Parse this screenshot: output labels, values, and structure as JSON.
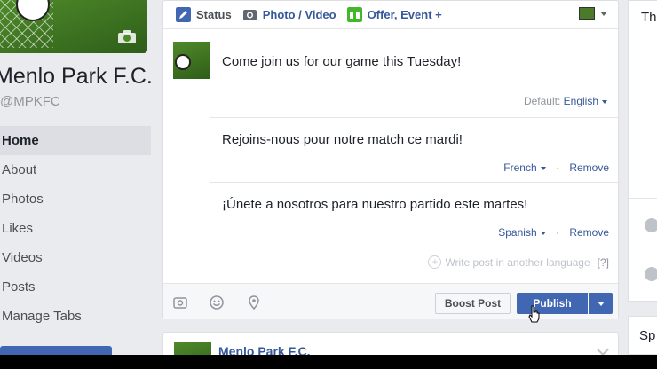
{
  "left": {
    "page_name": "Menlo Park F.C.",
    "page_handle": "@MPKFC",
    "nav": [
      {
        "label": "Home",
        "active": true
      },
      {
        "label": "About"
      },
      {
        "label": "Photos"
      },
      {
        "label": "Likes"
      },
      {
        "label": "Videos"
      },
      {
        "label": "Posts"
      },
      {
        "label": "Manage Tabs"
      }
    ]
  },
  "composer": {
    "tabs": {
      "status": "Status",
      "photo_video": "Photo / Video",
      "offer_event": "Offer, Event +"
    },
    "post_text": "Come join us for our game this Tuesday!",
    "default_label": "Default:",
    "default_language": "English",
    "translations": [
      {
        "text": "Rejoins-nous pour notre match ce mardi!",
        "language": "French",
        "remove": "Remove"
      },
      {
        "text": "¡Únete a nosotros para nuestro partido este martes!",
        "language": "Spanish",
        "remove": "Remove"
      }
    ],
    "write_more": "Write post in another language",
    "help": "[?]",
    "boost_label": "Boost Post",
    "publish_label": "Publish"
  },
  "next_post": {
    "name": "Menlo Park F.C."
  },
  "right": {
    "card1_title": "Th",
    "card2_title": "Sp"
  },
  "colors": {
    "brand_blue": "#4267b2",
    "link_blue": "#365899",
    "background": "#e9ebee"
  }
}
